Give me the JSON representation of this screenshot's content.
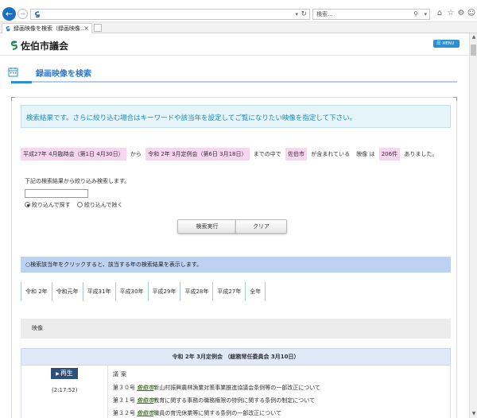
{
  "browser": {
    "search_placeholder": "検索...",
    "tab_title": "録画映像を検索（録画映像...",
    "tab_close": "×"
  },
  "site": {
    "logo_text": "佐伯市議会",
    "menu_label": "MENU"
  },
  "page": {
    "title": "録画映像を検索"
  },
  "results": {
    "info": "検索結果です。さらに絞り込む場合はキーワードや該当年を設定してご覧になりたい映像を指定して下さい。",
    "from": "平成27年 4月臨時会（第1日 4月30日）",
    "kara": "から",
    "to": "令和 2年 3月定例会（第6日 3月18日）",
    "until": "までの中で",
    "keyword": "佐伯市",
    "contains": "が含まれている",
    "video_word": "映像 は",
    "count": "206件",
    "arimashita": "ありました。"
  },
  "filter": {
    "label": "下記の検索結果から絞り込み検索します。",
    "input_value": "",
    "radio_include": "絞り込んで探す",
    "radio_exclude": "絞り込んで除く",
    "search_button": "検索実行",
    "clear_button": "クリア"
  },
  "year_hint": "○検索該当年をクリックすると、該当する年の検索結果を表示します。",
  "years": [
    "令和 2年",
    "令和元年",
    "平成31年",
    "平成30年",
    "平成29年",
    "平成28年",
    "平成27年",
    "全年"
  ],
  "video_section": {
    "label": "映像"
  },
  "session": {
    "title": "令和 2年 3月定例会 （総務常任委員会 3月10日）",
    "play_label": "再生",
    "duration": "(2:17:52)",
    "agenda_label": "議案",
    "items": [
      {
        "prefix": "第３０号 ",
        "keyword": "佐伯市",
        "text": "新山村振興農林漁業対策事業推進協議会条例等の一部改正について"
      },
      {
        "prefix": "第３１号 ",
        "keyword": "佐伯市",
        "text": "教育に関する事務の職務権限の特例に関する条例の制定について"
      },
      {
        "prefix": "第３２号 ",
        "keyword": "佐伯市",
        "text": "職員の育児休業等に関する条例の一部改正について"
      }
    ]
  },
  "colors": {
    "accent": "#2a8fd6",
    "chip": "#f9d6f0",
    "hint_bar": "#bcd2f3",
    "play": "#2d4f7c",
    "keyword": "#3a7a1a"
  }
}
